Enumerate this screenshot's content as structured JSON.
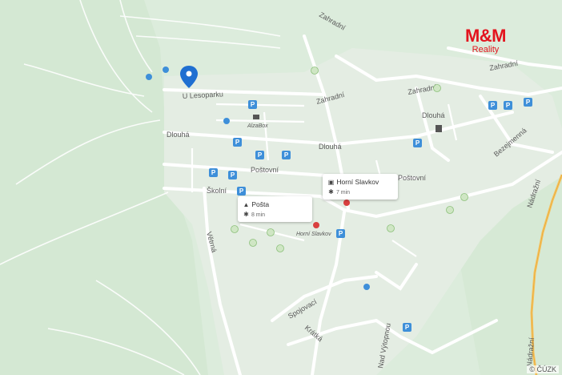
{
  "map": {
    "colors": {
      "land": "#dfeee0",
      "town": "#e6eee4",
      "road": "#ffffff",
      "main_road": "#f4c462",
      "parking": "#3e8fd9",
      "pin": "#1f6fd1"
    },
    "streets": [
      {
        "key": "s1",
        "text": "U Lesoparku"
      },
      {
        "key": "s2",
        "text": "Dlouhá"
      },
      {
        "key": "s3",
        "text": "Dlouhá"
      },
      {
        "key": "s4",
        "text": "Dlouhá"
      },
      {
        "key": "s5",
        "text": "Poštovní"
      },
      {
        "key": "s6",
        "text": "Poštovní"
      },
      {
        "key": "s7",
        "text": "Školní"
      },
      {
        "key": "s8",
        "text": "Větrná"
      },
      {
        "key": "s9",
        "text": "Zahradní"
      },
      {
        "key": "s10",
        "text": "Zahradní"
      },
      {
        "key": "s11",
        "text": "Zahradní"
      },
      {
        "key": "s12",
        "text": "Zahradní"
      },
      {
        "key": "s13",
        "text": "Bezejmenná"
      },
      {
        "key": "s14",
        "text": "Nádražní"
      },
      {
        "key": "s15",
        "text": "Spojovací"
      },
      {
        "key": "s16",
        "text": "Krátká"
      },
      {
        "key": "s17",
        "text": "Nad Výtopnou"
      },
      {
        "key": "s18",
        "text": "Nádražní"
      }
    ],
    "pois": {
      "alzabox": "AlzaBox",
      "bus_stop_label": "Horní Slavkov"
    },
    "callouts": {
      "bus": {
        "name": "Horní Slavkov",
        "time": "7 min"
      },
      "post": {
        "name": "Pošta",
        "time": "8 min"
      }
    },
    "parking_symbol": "P",
    "pin_icon": "location-pin-icon"
  },
  "brand": {
    "line1": "M&M",
    "line2": "Reality"
  },
  "copyright": "© ČÚZK"
}
